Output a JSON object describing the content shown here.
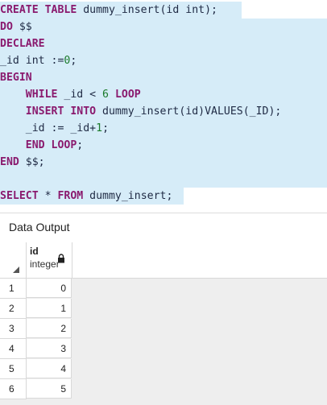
{
  "editor": {
    "l1": {
      "kw1": "CREATE TABLE",
      "rest": " dummy_insert(id int);"
    },
    "l2": {
      "kw": "DO",
      "rest": " $$"
    },
    "l3": {
      "kw": "DECLARE"
    },
    "l4": {
      "pre": "_id int :=",
      "num": "0",
      "post": ";"
    },
    "l5": {
      "kw": "BEGIN"
    },
    "l6": {
      "indent": "    ",
      "kw1": "WHILE",
      "mid": " _id < ",
      "num": "6",
      "sp": " ",
      "kw2": "LOOP"
    },
    "l7": {
      "indent": "    ",
      "kw": "INSERT INTO",
      "rest": " dummy_insert(id)VALUES(_ID);"
    },
    "l8": {
      "indent": "    ",
      "pre": "_id := _id+",
      "num": "1",
      "post": ";"
    },
    "l9": {
      "indent": "    ",
      "kw": "END LOOP",
      "post": ";"
    },
    "l10": {
      "kw": "END",
      "rest": " $$;"
    },
    "l12": {
      "kw1": "SELECT",
      "mid": " * ",
      "kw2": "FROM",
      "rest": " dummy_insert;"
    }
  },
  "output": {
    "title": "Data Output",
    "column": {
      "name": "id",
      "type": "integer"
    },
    "rows": [
      {
        "num": "1",
        "id": "0"
      },
      {
        "num": "2",
        "id": "1"
      },
      {
        "num": "3",
        "id": "2"
      },
      {
        "num": "4",
        "id": "3"
      },
      {
        "num": "5",
        "id": "4"
      },
      {
        "num": "6",
        "id": "5"
      }
    ]
  },
  "colors": {
    "highlight": "#d6ecf8",
    "keyword": "#8a1a6e",
    "number": "#1a7a2a"
  },
  "icons": [
    "lock-icon",
    "sort-corner-icon"
  ]
}
